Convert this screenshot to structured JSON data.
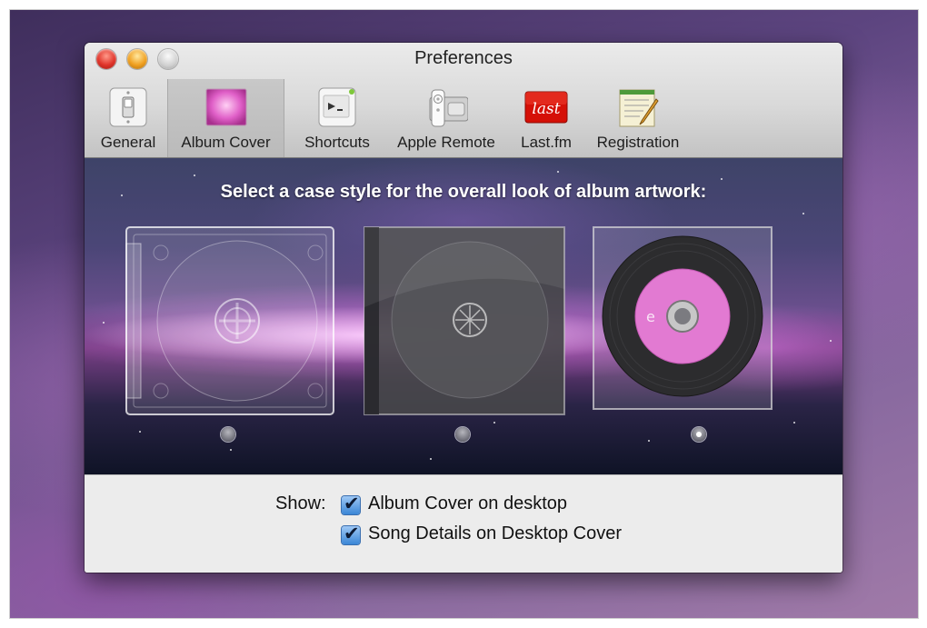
{
  "window": {
    "title": "Preferences"
  },
  "toolbar": {
    "items": [
      {
        "label": "General",
        "icon": "light-switch-icon",
        "selected": false
      },
      {
        "label": "Album Cover",
        "icon": "album-cover-icon",
        "selected": true
      },
      {
        "label": "Shortcuts",
        "icon": "shortcuts-icon",
        "selected": false
      },
      {
        "label": "Apple Remote",
        "icon": "apple-remote-icon",
        "selected": false
      },
      {
        "label": "Last.fm",
        "icon": "lastfm-icon",
        "selected": false
      },
      {
        "label": "Registration",
        "icon": "registration-icon",
        "selected": false
      }
    ]
  },
  "album_cover": {
    "heading": "Select a case style for the overall look of album artwork:",
    "styles": [
      {
        "name": "clear-jewel-case",
        "selected": false
      },
      {
        "name": "black-jewel-case",
        "selected": false
      },
      {
        "name": "vinyl-cd-case",
        "selected": true
      }
    ]
  },
  "show": {
    "label": "Show:",
    "options": [
      {
        "label": "Album Cover on desktop",
        "checked": true
      },
      {
        "label": "Song Details on Desktop Cover",
        "checked": true
      }
    ]
  },
  "colors": {
    "accent": "#3b86d6",
    "lastfm": "#d51007"
  }
}
